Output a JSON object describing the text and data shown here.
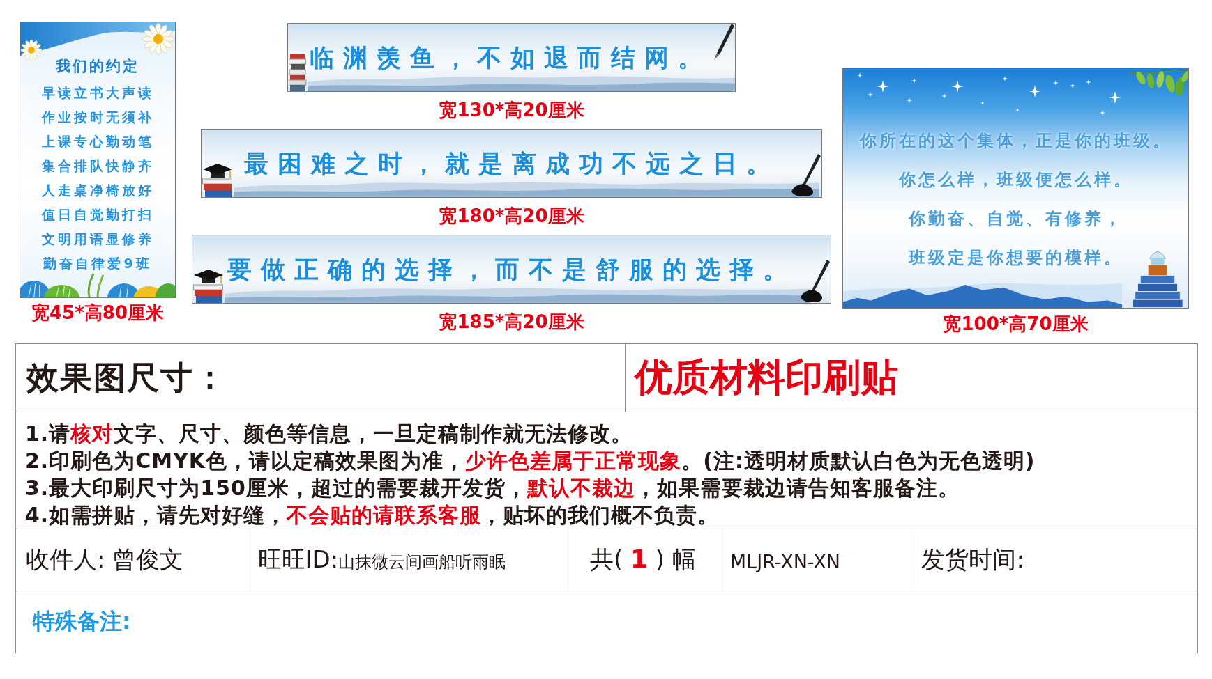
{
  "left_poster": {
    "title": "我们的约定",
    "lines": [
      "早读立书大声读",
      "作业按时无须补",
      "上课专心勤动笔",
      "集合排队快静齐",
      "人走桌净椅放好",
      "值日自觉勤打扫",
      "文明用语显修养",
      "勤奋自律爱9班"
    ],
    "size_label": "宽45*高80厘米"
  },
  "banners": [
    {
      "text": "临渊羡鱼，不如退而结网。",
      "size_label": "宽130*高20厘米"
    },
    {
      "text": "最困难之时，就是离成功不远之日。",
      "size_label": "宽180*高20厘米"
    },
    {
      "text": "要做正确的选择，而不是舒服的选择。",
      "size_label": "宽185*高20厘米"
    }
  ],
  "right_poster": {
    "lines": [
      "你所在的这个集体，正是你的班级。",
      "你怎么样，班级便怎么样。",
      "你勤奋、自觉、有修养，",
      "班级定是你想要的模样。"
    ],
    "size_label": "宽100*高70厘米"
  },
  "order_form": {
    "heading": "效果图尺寸：",
    "product": "优质材料印刷贴",
    "notes": [
      {
        "segments": [
          {
            "kind": "plain",
            "text": "1.请"
          },
          {
            "kind": "emphasis",
            "text": "核对"
          },
          {
            "kind": "plain",
            "text": "文字、尺寸、颜色等信息，一旦定稿制作就无法修改。"
          }
        ]
      },
      {
        "segments": [
          {
            "kind": "plain",
            "text": "2.印刷色为CMYK色，请以定稿效果图为准，"
          },
          {
            "kind": "emphasis",
            "text": "少许色差属于正常现象"
          },
          {
            "kind": "plain",
            "text": "。(注:透明材质默认白色为无色透明)"
          }
        ]
      },
      {
        "segments": [
          {
            "kind": "plain",
            "text": "3.最大印刷尺寸为150厘米，超过的需要裁开发货，"
          },
          {
            "kind": "emphasis",
            "text": "默认不裁边"
          },
          {
            "kind": "plain",
            "text": "，如果需要裁边请告知客服备注。"
          }
        ]
      },
      {
        "segments": [
          {
            "kind": "plain",
            "text": "4.如需拼贴，请先对好缝，"
          },
          {
            "kind": "emphasis",
            "text": "不会贴的请联系客服"
          },
          {
            "kind": "plain",
            "text": "，贴坏的我们概不负责。"
          }
        ]
      }
    ],
    "fields": [
      {
        "segments": [
          {
            "kind": "plain",
            "text": "收件人: 曾俊文"
          }
        ]
      },
      {
        "segments": [
          {
            "kind": "plain",
            "text": "旺旺ID:"
          },
          {
            "kind": "small",
            "text": "山抹微云间画船听雨眠"
          }
        ]
      },
      {
        "segments": [
          {
            "kind": "plain",
            "text": "共( "
          },
          {
            "kind": "emphasis",
            "text": "1"
          },
          {
            "kind": "plain",
            "text": " ) 幅"
          }
        ]
      },
      {
        "segments": [
          {
            "kind": "code",
            "text": "MLJR-XN-XN"
          }
        ]
      },
      {
        "segments": [
          {
            "kind": "plain",
            "text": "发货时间:"
          }
        ]
      }
    ],
    "remarks_label": "特殊备注:"
  }
}
